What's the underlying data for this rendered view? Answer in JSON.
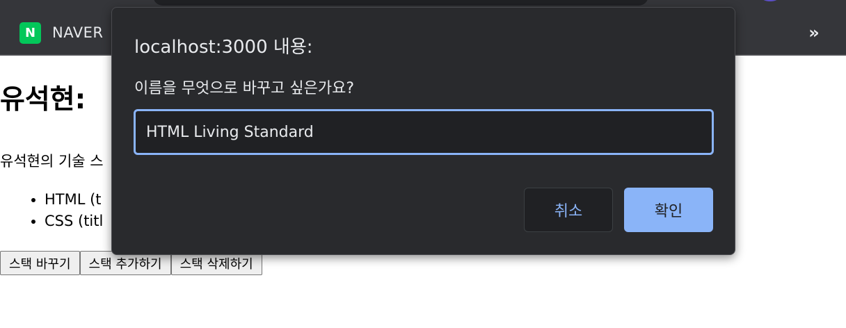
{
  "browser": {
    "bookmark": {
      "logo_text": "N",
      "label": "NAVER"
    },
    "more_bookmarks": "»"
  },
  "page": {
    "title": "유석현:",
    "stack_intro": "유석현의 기술 스",
    "stack_items": [
      "HTML (t",
      "CSS (titl"
    ],
    "buttons": [
      "스택 바꾸기",
      "스택 추가하기",
      "스택 삭제하기"
    ]
  },
  "dialog": {
    "title": "localhost:3000 내용:",
    "message": "이름을 무엇으로 바꾸고 싶은가요?",
    "input_value": "HTML Living Standard",
    "cancel_label": "취소",
    "ok_label": "확인"
  },
  "colors": {
    "dialog_bg": "#292a2d",
    "accent": "#8ab4f8",
    "naver_green": "#03c75a"
  }
}
